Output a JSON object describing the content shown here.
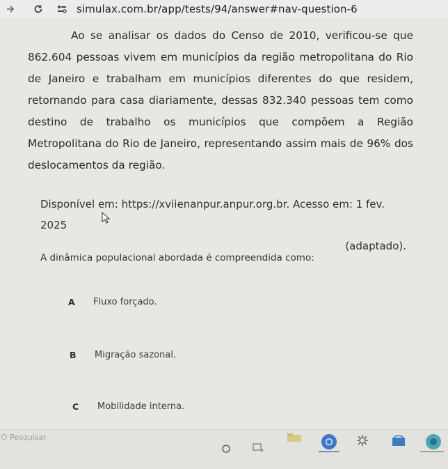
{
  "browser": {
    "url": "simulax.com.br/app/tests/94/answer#nav-question-6"
  },
  "question": {
    "text": "Ao se analisar os dados do Censo de 2010, verificou-se que 862.604 pessoas vivem em municípios da região metropolitana do Rio de Janeiro e trabalham em municípios diferentes do que residem, retornando para casa diariamente, dessas 832.340 pessoas tem como destino de trabalho os municípios que compõem a Região Metropolitana do Rio de Janeiro, representando assim mais de 96% dos deslocamentos da região.",
    "source_line1": "Disponível em: https://xviienanpur.anpur.org.br. Acesso em: 1 fev. 2025",
    "source_line2": "(adaptado).",
    "prompt": "A dinâmica populacional abordada é compreendida como:",
    "options": [
      {
        "letter": "A",
        "text": "Fluxo forçado."
      },
      {
        "letter": "B",
        "text": "Migração sazonal."
      },
      {
        "letter": "C",
        "text": "Mobilidade interna."
      }
    ]
  },
  "taskbar": {
    "search_placeholder": "Pesquisar"
  }
}
